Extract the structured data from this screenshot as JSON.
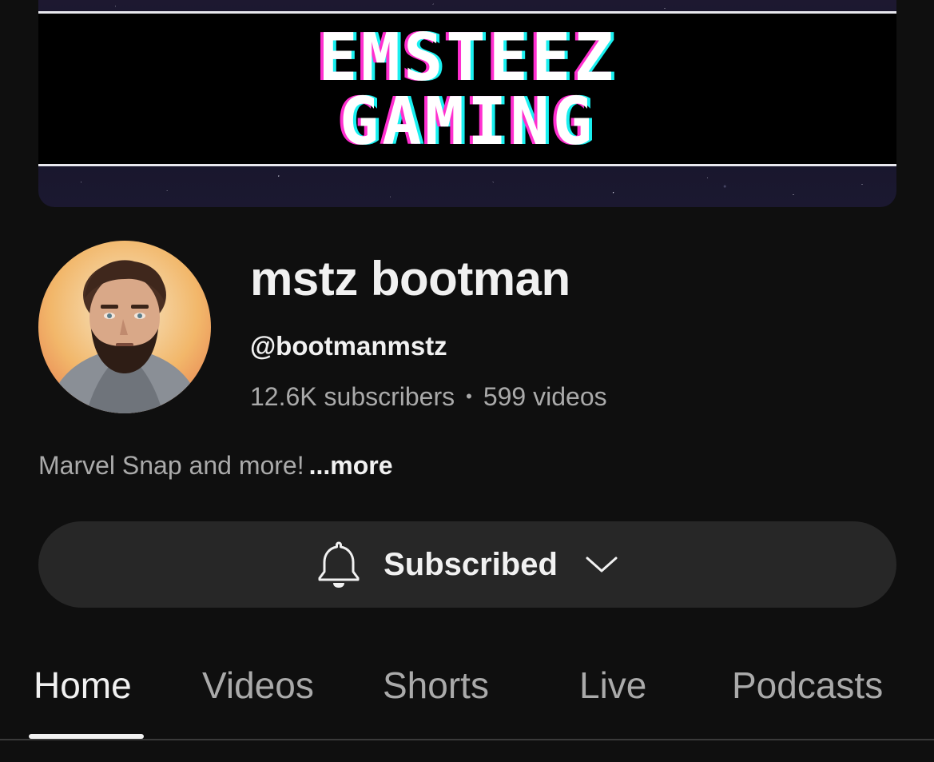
{
  "banner": {
    "line1": "EMSTEEZ",
    "line2": "GAMING"
  },
  "channel": {
    "name": "mstz bootman",
    "handle": "@bootmanmstz",
    "subscribers": "12.6K subscribers",
    "separator": "•",
    "videos": "599 videos",
    "description": "Marvel Snap and more!",
    "more_label": "...more"
  },
  "subscribe": {
    "label": "Subscribed",
    "bell_icon": "bell-icon",
    "chevron_icon": "chevron-down-icon"
  },
  "tabs": [
    {
      "label": "Home",
      "active": true
    },
    {
      "label": "Videos",
      "active": false
    },
    {
      "label": "Shorts",
      "active": false
    },
    {
      "label": "Live",
      "active": false
    },
    {
      "label": "Podcasts",
      "active": false
    }
  ],
  "colors": {
    "background": "#0f0f0f",
    "text_primary": "#f1f1f1",
    "text_secondary": "#aaaaaa",
    "button_bg": "#272727",
    "banner_glitch_pink": "#ff2fd0",
    "banner_glitch_cyan": "#19f0f0"
  }
}
